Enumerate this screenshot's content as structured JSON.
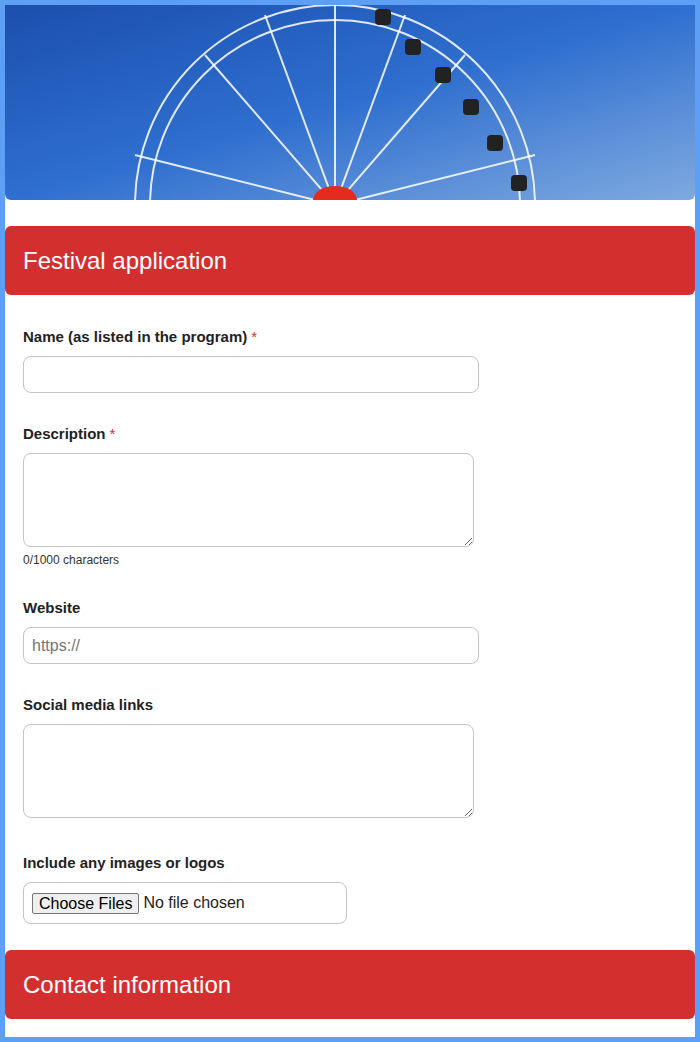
{
  "required_marker": "*",
  "sections": [
    {
      "title": "Festival application",
      "fields": [
        {
          "kind": "text",
          "label": "Name (as listed in the program)",
          "required": true
        },
        {
          "kind": "textarea",
          "label": "Description",
          "required": true,
          "counter": "0/1000 characters"
        },
        {
          "kind": "text",
          "label": "Website",
          "required": false,
          "placeholder": "https://"
        },
        {
          "kind": "textarea",
          "label": "Social media links",
          "required": false
        },
        {
          "kind": "file",
          "label": "Include any images or logos",
          "required": false,
          "button": "Choose Files",
          "status": "No file chosen"
        }
      ]
    },
    {
      "title": "Contact information",
      "fields": []
    }
  ]
}
